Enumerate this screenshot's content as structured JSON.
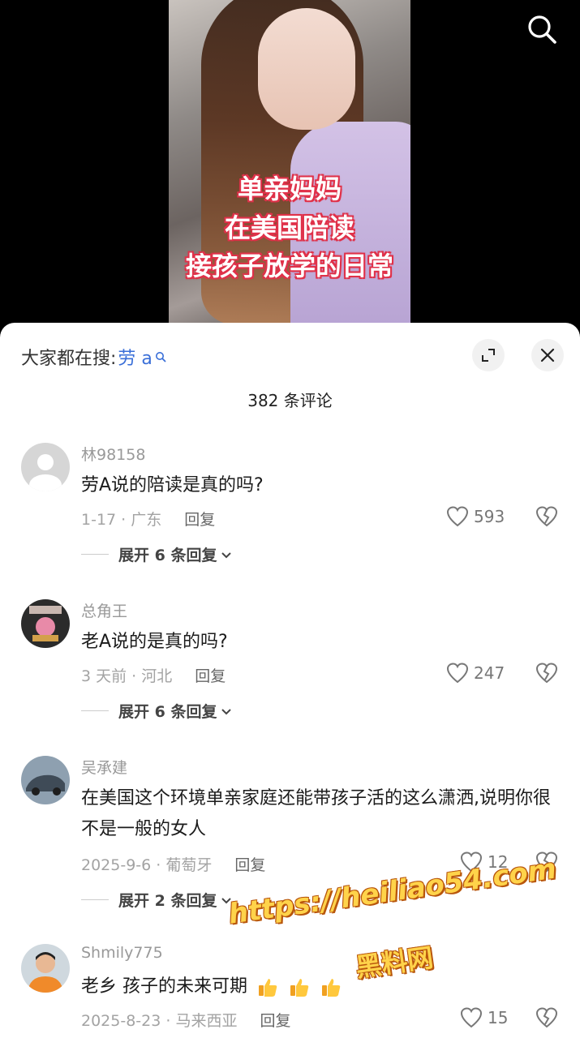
{
  "video": {
    "overlay_lines": [
      "单亲妈妈",
      "在美国陪读",
      "接孩子放学的日常"
    ]
  },
  "sheet": {
    "search_prefix": "大家都在搜:",
    "search_keyword": "劳 a",
    "comment_count": "382 条评论"
  },
  "comments": [
    {
      "username": "林98158",
      "text": "劳A说的陪读是真的吗?",
      "date_location": "1-17 · 广东",
      "reply": "回复",
      "likes": "593",
      "expand": "展开 6 条回复"
    },
    {
      "username": "总角王",
      "text": "老A说的是真的吗?",
      "date_location": "3 天前 · 河北",
      "reply": "回复",
      "likes": "247",
      "expand": "展开 6 条回复"
    },
    {
      "username": "吴承建",
      "text": "在美国这个环境单亲家庭还能带孩子活的这么潇洒,说明你很不是一般的女人",
      "date_location": "2025-9-6 · 葡萄牙",
      "reply": "回复",
      "likes": "12",
      "expand": "展开 2 条回复"
    },
    {
      "username": "Shmily775",
      "text": "老乡 孩子的未来可期",
      "date_location": "2025-8-23 · 马来西亚",
      "reply": "回复",
      "likes": "15"
    }
  ],
  "watermark": {
    "url": "https://heiliao54.com",
    "name": "黑料网"
  },
  "icons": {
    "search": "search-icon",
    "expand": "expand-icon",
    "close": "close-icon",
    "like": "heart-icon",
    "dislike": "broken-heart-icon",
    "chevron": "chevron-down-icon",
    "thumbs": "thumbs-up-emoji"
  },
  "colors": {
    "keyword": "#3a6fd8",
    "overlay_outline": "#e0324a",
    "watermark": "#ffd34a"
  }
}
